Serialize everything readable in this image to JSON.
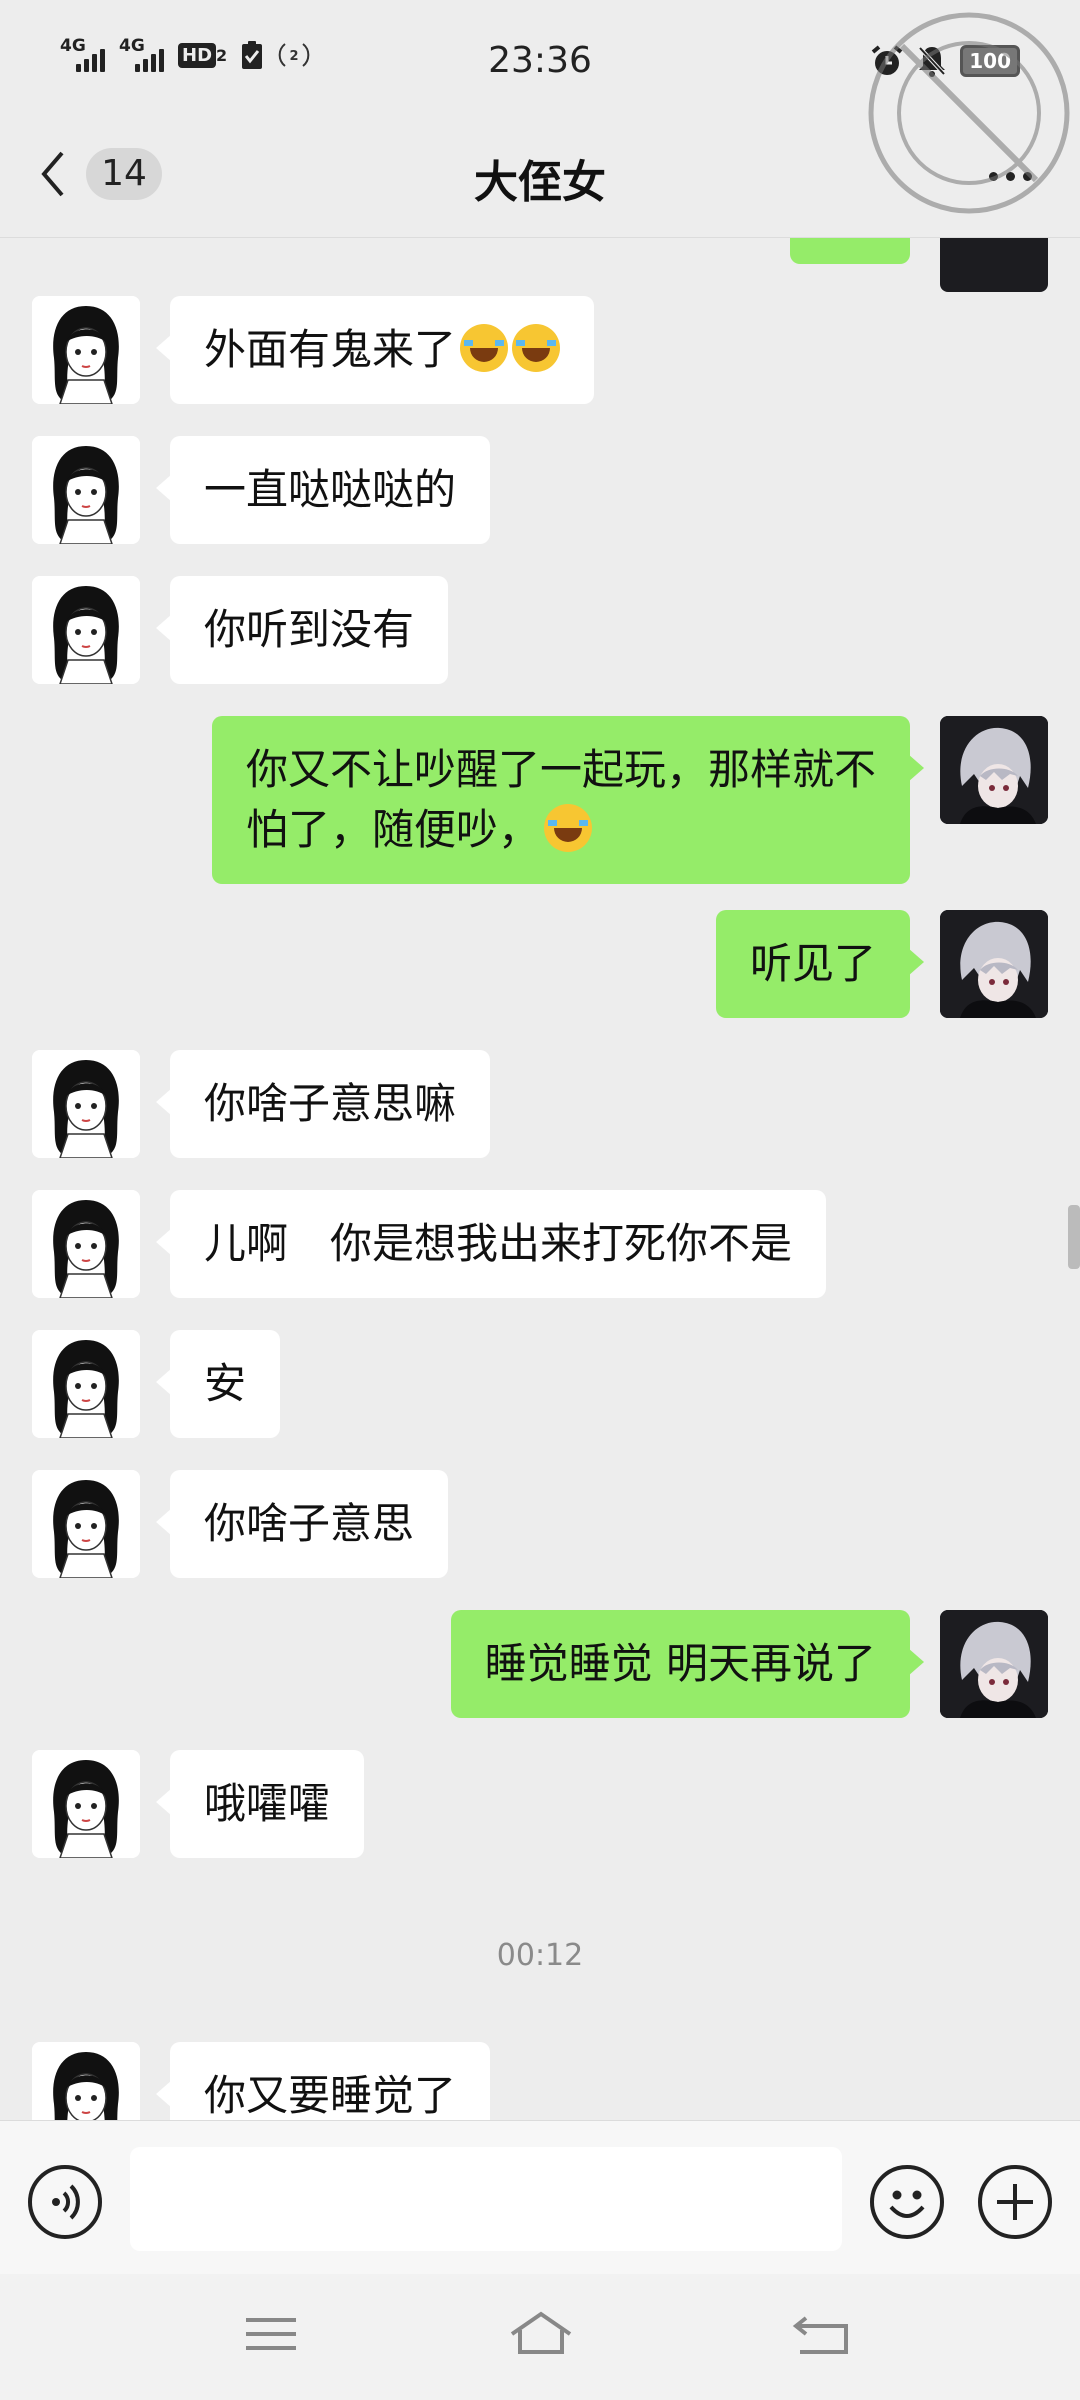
{
  "status_bar": {
    "network_1": "4G",
    "network_2": "4G",
    "hd_label": "HD",
    "hd_sub": "2",
    "time": "23:36",
    "battery": "100"
  },
  "header": {
    "unread_count": "14",
    "title": "大侄女"
  },
  "messages": [
    {
      "side": "left",
      "text": "外面有鬼来了",
      "emojis": 2
    },
    {
      "side": "left",
      "text": "一直哒哒哒的"
    },
    {
      "side": "left",
      "text": "你听到没有"
    },
    {
      "side": "right",
      "text_line1": "你又不让吵醒了一起玩，那样就不",
      "text_line2": "怕了，随便吵，",
      "emojis": 1
    },
    {
      "side": "right",
      "text": "听见了"
    },
    {
      "side": "left",
      "text": "你啥子意思嘛"
    },
    {
      "side": "left",
      "text": "儿啊　你是想我出来打死你不是"
    },
    {
      "side": "left",
      "text": "安"
    },
    {
      "side": "left",
      "text": "你啥子意思"
    },
    {
      "side": "right",
      "text": "睡觉睡觉 明天再说了"
    },
    {
      "side": "left",
      "text": "哦嚯嚯"
    },
    {
      "side": "left",
      "text": "你又要睡觉了"
    }
  ],
  "timestamp": "00:12",
  "input": {
    "value": "",
    "placeholder": ""
  },
  "icons": {
    "back": "chevron-left-icon",
    "more": "more-dots-icon",
    "voice": "voice-icon",
    "emoji": "emoji-icon",
    "plus": "plus-icon",
    "nav_menu": "menu-icon",
    "nav_home": "home-icon",
    "nav_back": "back-icon"
  },
  "colors": {
    "sent_bubble": "#95ec69",
    "received_bubble": "#ffffff",
    "background": "#ededed"
  }
}
